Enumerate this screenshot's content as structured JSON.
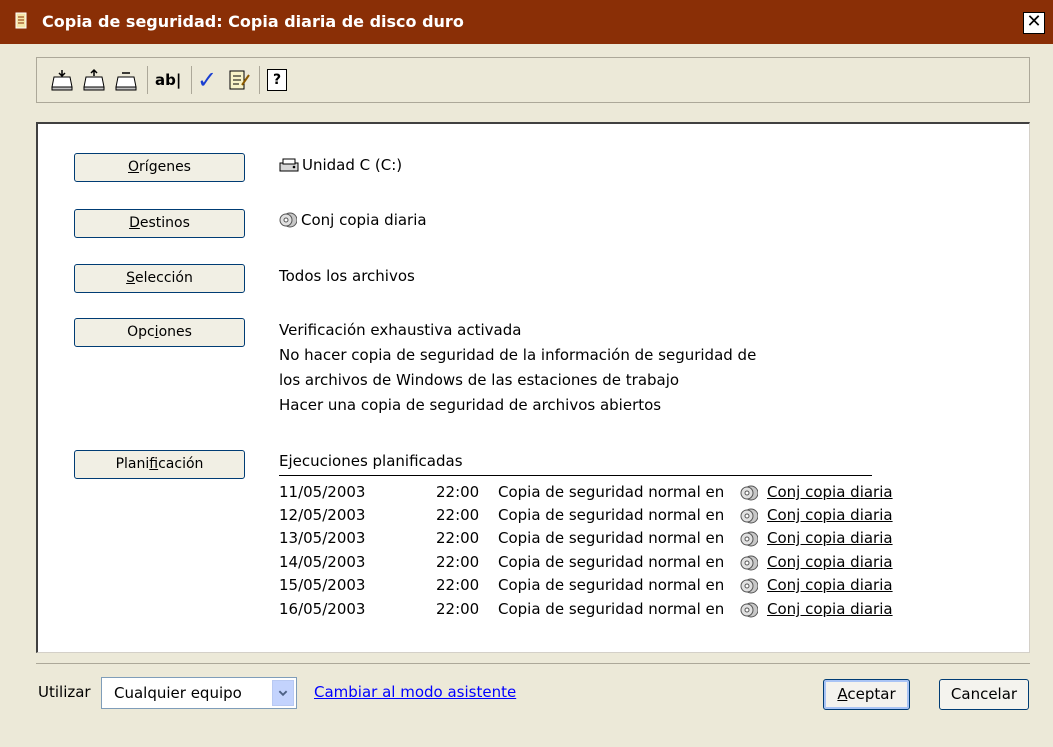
{
  "window": {
    "title": "Copia de seguridad: Copia diaria de disco duro",
    "close_label": "✕"
  },
  "toolbar": {
    "items": [
      {
        "icon": "tray-icon",
        "name": "tray-1"
      },
      {
        "icon": "tray-up-icon",
        "name": "tray-2"
      },
      {
        "icon": "tray-icon",
        "name": "tray-3"
      },
      {
        "icon": "rename-icon",
        "label": "ab|"
      },
      {
        "icon": "checkmark-icon",
        "label": "✓"
      },
      {
        "icon": "notepad-icon"
      },
      {
        "icon": "help-icon",
        "label": "?"
      }
    ]
  },
  "sections": {
    "origins": {
      "label_pre": "",
      "label_mn": "O",
      "label_post": "rígenes",
      "value": "Unidad C (C:)",
      "icon": "drive-icon"
    },
    "destinations": {
      "label_pre": "",
      "label_mn": "D",
      "label_post": "estinos",
      "value": "Conj copia diaria",
      "icon": "disc-icon"
    },
    "selection": {
      "label_pre": "",
      "label_mn": "S",
      "label_post": "elección",
      "value": "Todos los archivos"
    },
    "options": {
      "label_pre": "Opc",
      "label_mn": "i",
      "label_post": "ones",
      "lines": [
        "Verificación exhaustiva activada",
        "No hacer copia de seguridad de la información de seguridad de",
        "los archivos de Windows de las estaciones de trabajo",
        "Hacer una copia de seguridad de archivos abiertos"
      ]
    },
    "schedule": {
      "label_pre": "Plani",
      "label_mn": "f",
      "label_post": "icación",
      "heading": "Ejecuciones planificadas",
      "rows": [
        {
          "date": "11/05/2003",
          "time": "22:00",
          "text": "Copia de seguridad normal en",
          "link": "Conj copia diaria"
        },
        {
          "date": "12/05/2003",
          "time": "22:00",
          "text": "Copia de seguridad normal en",
          "link": "Conj copia diaria"
        },
        {
          "date": "13/05/2003",
          "time": "22:00",
          "text": "Copia de seguridad normal en",
          "link": "Conj copia diaria"
        },
        {
          "date": "14/05/2003",
          "time": "22:00",
          "text": "Copia de seguridad normal en",
          "link": "Conj copia diaria"
        },
        {
          "date": "15/05/2003",
          "time": "22:00",
          "text": "Copia de seguridad normal en",
          "link": "Conj copia diaria"
        },
        {
          "date": "16/05/2003",
          "time": "22:00",
          "text": "Copia de seguridad normal en",
          "link": "Conj copia diaria"
        }
      ]
    }
  },
  "footer": {
    "use_label": "Utilizar",
    "device_select": "Cualquier equipo",
    "wizard_link": "Cambiar al modo asistente",
    "ok_pre": "",
    "ok_mn": "A",
    "ok_post": "ceptar",
    "cancel_label": "Cancelar"
  },
  "colors": {
    "titlebar": "#8a2f06",
    "link": "#0000ff",
    "button_border": "#003c74"
  }
}
